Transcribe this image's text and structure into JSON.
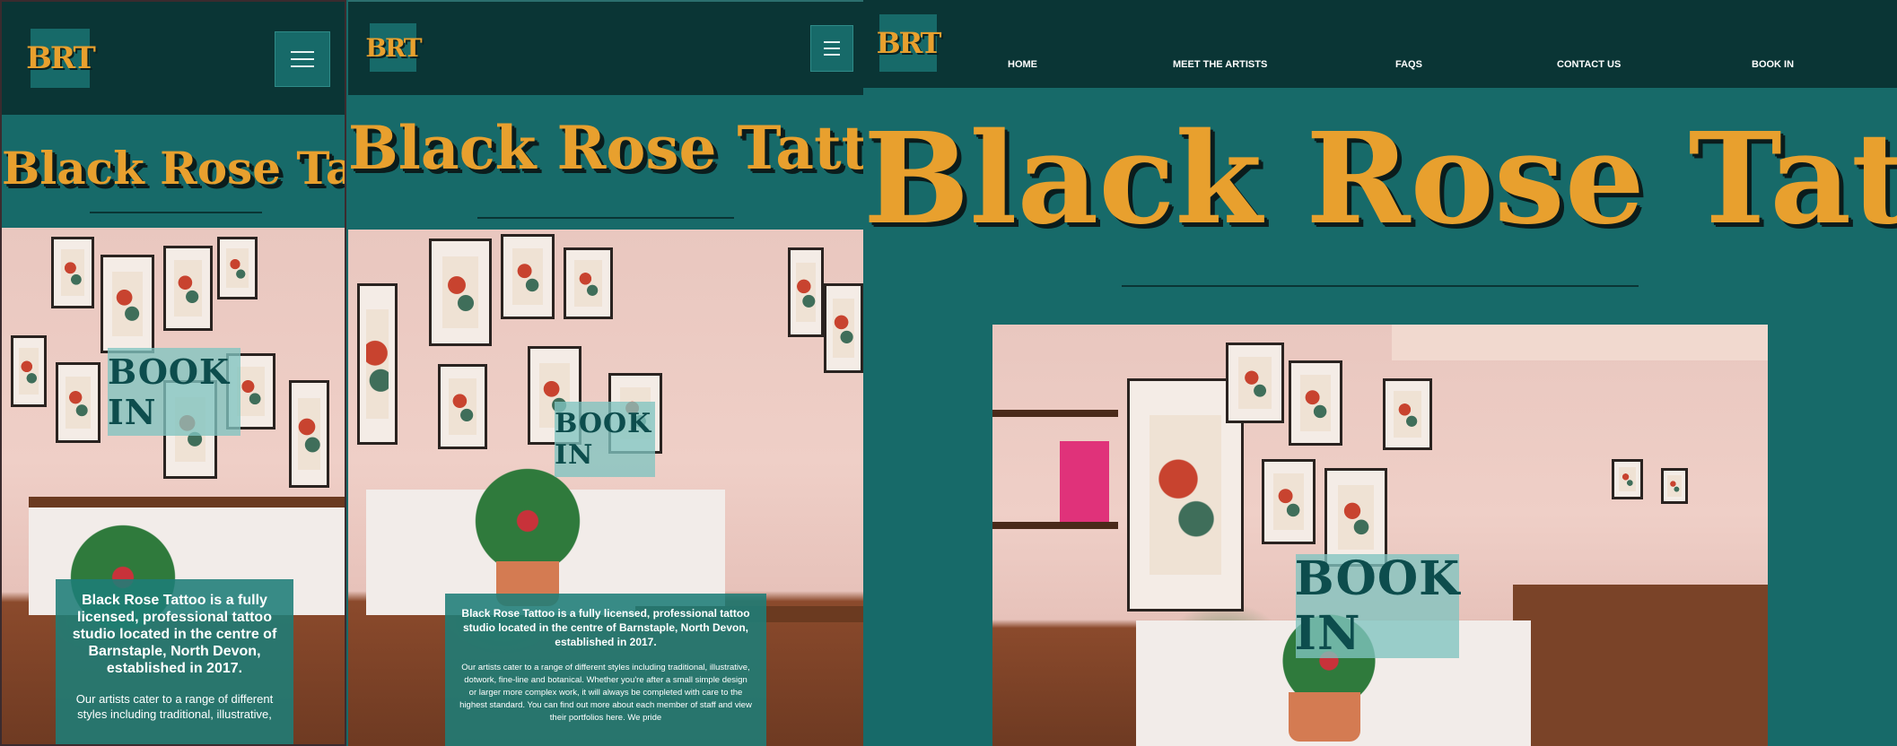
{
  "brand": {
    "logo_text": "BRT",
    "title": "Black Rose Tattoo"
  },
  "nav": {
    "menu_icon": "hamburger-menu-icon",
    "items": [
      "HOME",
      "MEET THE ARTISTS",
      "FAQS",
      "CONTACT US",
      "BOOK IN"
    ]
  },
  "hero": {
    "book_label": "BOOK IN"
  },
  "intro": {
    "lead": "Black Rose Tattoo is a fully licensed, professional tattoo studio located in the centre of Barnstaple, North Devon, established in 2017.",
    "mobile_body": "Our artists cater to a range of different styles including traditional, illustrative,",
    "tablet_body": "Our artists cater to a range of different styles including traditional, illustrative, dotwork, fine-line and botanical. Whether you're after a small simple design or larger more complex work, it will always be completed with care to the highest standard. You can find out more about each member of staff and view their portfolios here. We pride"
  },
  "colors": {
    "header": "#0a3535",
    "teal": "#176a69",
    "gold": "#e8a02e",
    "book_bg": "#80c4c0"
  }
}
